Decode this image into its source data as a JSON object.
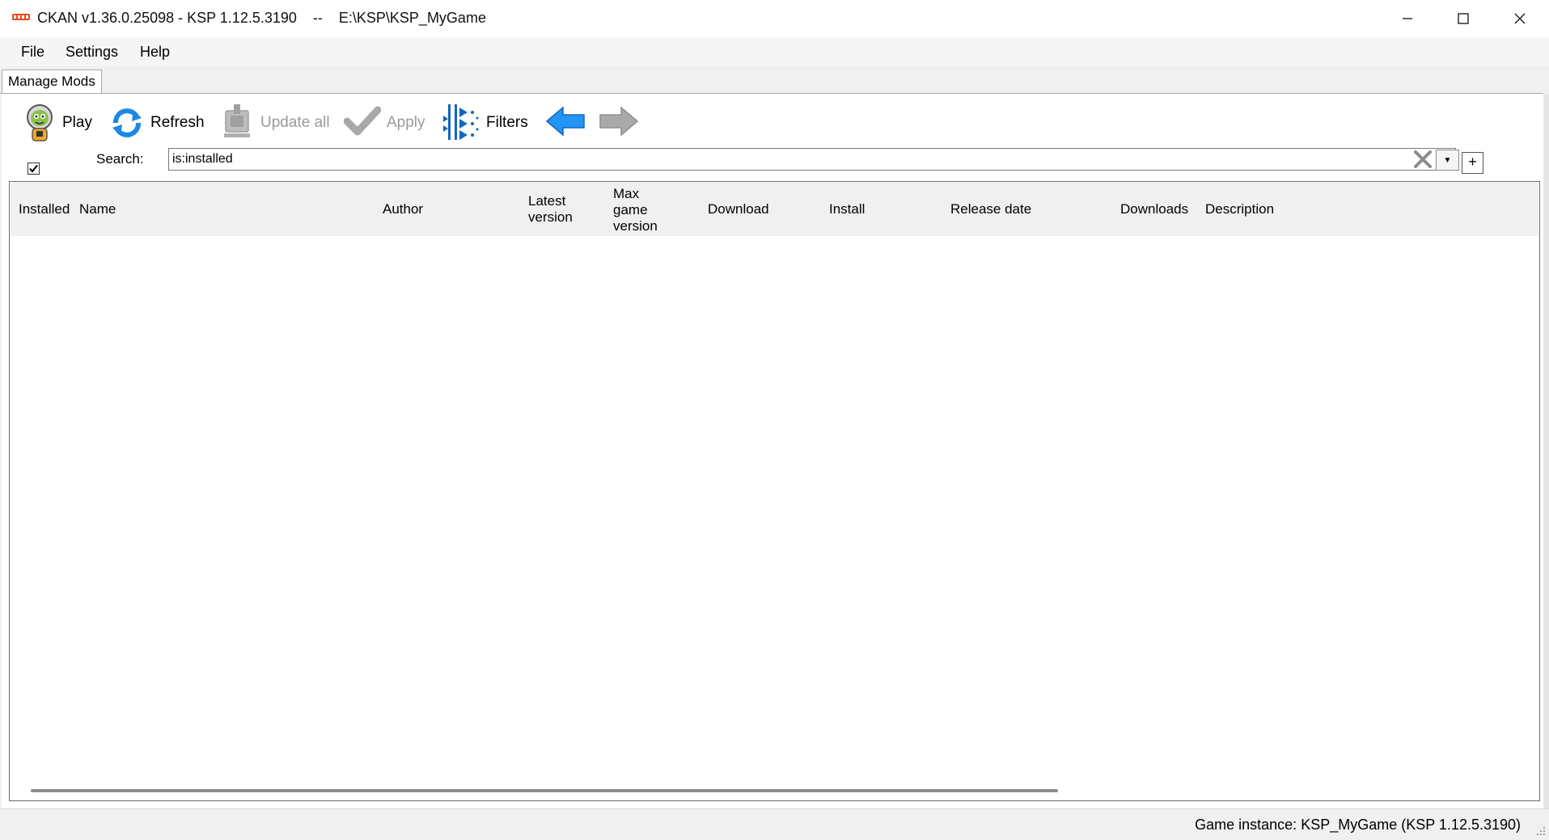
{
  "window": {
    "title": "CKAN v1.36.0.25098 - KSP 1.12.5.3190    --    E:\\KSP\\KSP_MyGame"
  },
  "menu": {
    "file": "File",
    "settings": "Settings",
    "help": "Help"
  },
  "tabs": {
    "manage_mods": "Manage Mods"
  },
  "toolbar": {
    "play": "Play",
    "refresh": "Refresh",
    "update_all": "Update all",
    "apply": "Apply",
    "filters": "Filters"
  },
  "search": {
    "label": "Search:",
    "value": "is:installed",
    "add_glyph": "+"
  },
  "grid": {
    "columns": [
      "Installed",
      "Name",
      "Author",
      "Latest\nversion",
      "Max\ngame\nversion",
      "Download",
      "Install",
      "Release date",
      "Downloads",
      "Description"
    ],
    "rows": []
  },
  "status": {
    "text": "Game instance: KSP_MyGame (KSP 1.12.5.3190)"
  },
  "colors": {
    "accent_blue": "#1e88e5",
    "disabled_gray": "#9a9a9a",
    "arrow_forward_gray": "#a9a9a9"
  },
  "icons": {
    "app": "ckan-icon",
    "play": "kerbal-icon",
    "refresh": "refresh-icon",
    "update_all": "update-all-icon",
    "apply": "checkmark-icon",
    "filters": "filters-icon",
    "back": "arrow-back-icon",
    "forward": "arrow-forward-icon"
  }
}
